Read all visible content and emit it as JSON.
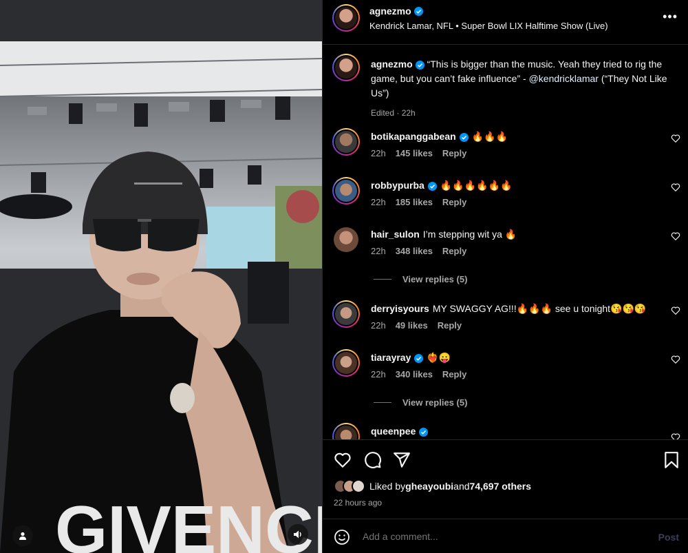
{
  "media": {
    "user_tag_icon": "person-icon",
    "sound_icon": "speaker-icon",
    "shirt_text": "GIVENCH"
  },
  "header": {
    "username": "agnezmo",
    "subtitle": "Kendrick Lamar, NFL • Super Bowl LIX Halftime Show (Live)",
    "more_icon": "•••"
  },
  "caption": {
    "username": "agnezmo",
    "text_before": " “This is bigger than the music. Yeah they tried to rig the game, but you can’t fake influence” - ",
    "mention": "@kendricklamar",
    "text_after": " (“They Not Like Us”)",
    "edited": "Edited · 22h"
  },
  "comments": [
    {
      "username": "botikapanggabean",
      "verified": true,
      "text": "🔥🔥🔥",
      "time": "22h",
      "likes": "145 likes",
      "reply": "Reply"
    },
    {
      "username": "robbypurba",
      "verified": true,
      "text": "🔥🔥🔥🔥🔥🔥",
      "time": "22h",
      "likes": "185 likes",
      "reply": "Reply"
    },
    {
      "username": "hair_sulon",
      "verified": false,
      "text": "I’m stepping wit ya 🔥",
      "time": "22h",
      "likes": "348 likes",
      "reply": "Reply",
      "view_replies": "View replies (5)"
    },
    {
      "username": "derryisyours",
      "verified": false,
      "text": "MY SWAGGY AG!!!🔥🔥🔥 see u tonight😘😘😘",
      "time": "22h",
      "likes": "49 likes",
      "reply": "Reply"
    },
    {
      "username": "tiarayray",
      "verified": true,
      "text": "❤️‍🔥😛",
      "time": "22h",
      "likes": "340 likes",
      "reply": "Reply",
      "view_replies": "View replies (5)"
    },
    {
      "username": "queenpee",
      "verified": true,
      "text": "",
      "time": "",
      "likes": "",
      "reply": ""
    }
  ],
  "actions": {
    "like_icon": "heart-icon",
    "comment_icon": "comment-icon",
    "share_icon": "send-icon",
    "save_icon": "bookmark-icon"
  },
  "likes": {
    "prefix": "Liked by ",
    "user": "gheayoubi",
    "middle": " and ",
    "count": "74,697 others"
  },
  "time_ago": "22 hours ago",
  "add_comment": {
    "placeholder": "Add a comment...",
    "post_label": "Post"
  },
  "colors": {
    "background": "#000000",
    "verified": "#0095f6",
    "muted": "#a8a8a8",
    "divider": "#262626"
  }
}
